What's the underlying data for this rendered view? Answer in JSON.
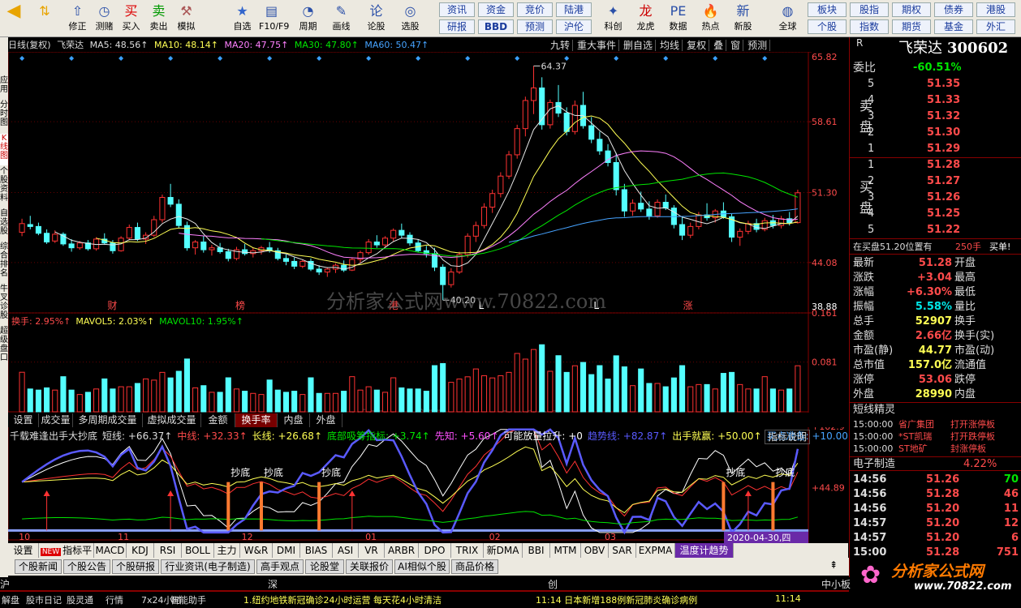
{
  "toolbar": {
    "buttons": [
      {
        "label": "修正",
        "icon": "arrow-up-icon"
      },
      {
        "label": "测赌",
        "icon": "clock-icon"
      },
      {
        "label": "买入",
        "icon": "buy-icon"
      },
      {
        "label": "卖出",
        "icon": "sell-icon"
      },
      {
        "label": "模拟",
        "icon": "hammer-icon"
      },
      {
        "label": "自选",
        "icon": "star-icon"
      },
      {
        "label": "F10/F9",
        "icon": "f10-icon"
      },
      {
        "label": "周期",
        "icon": "period-icon"
      },
      {
        "label": "画线",
        "icon": "pen-icon"
      },
      {
        "label": "论股",
        "icon": "discuss-icon"
      },
      {
        "label": "选股",
        "icon": "select-icon"
      },
      {
        "label": "科创",
        "icon": "science-icon"
      },
      {
        "label": "龙虎",
        "icon": "dragon-icon"
      },
      {
        "label": "数据",
        "icon": "pe-icon"
      },
      {
        "label": "热点",
        "icon": "hot-icon"
      },
      {
        "label": "新股",
        "icon": "newstock-icon"
      },
      {
        "label": "全球",
        "icon": "globe-icon"
      }
    ],
    "small_buttons": [
      "资讯",
      "资金",
      "竞价",
      "陆港",
      "研报",
      "BBD",
      "预测",
      "沪伦"
    ],
    "right_buttons": [
      "板块",
      "股指",
      "期权",
      "债券",
      "港股",
      "个股",
      "指数",
      "期货",
      "基金",
      "外汇"
    ]
  },
  "chart_header": {
    "period": "日线(复权)",
    "name": "飞荣达",
    "ma5": "MA5: 48.56↑",
    "ma10": "MA10: 48.14↑",
    "ma20": "MA20: 47.75↑",
    "ma30": "MA30: 47.80↑",
    "ma60": "MA60: 50.47↑",
    "tools": [
      "九转",
      "重大事件",
      "删自选",
      "均线",
      "复权",
      "叠",
      "窗",
      "预测"
    ]
  },
  "price_axis": [
    "65.82",
    "58.61",
    "51.30",
    "44.08",
    "38.88"
  ],
  "annotations": {
    "high": "64.37",
    "low": "40.20",
    "events": [
      "财",
      "榜",
      "港",
      "L",
      "L",
      "涨"
    ]
  },
  "watermark": "分析家公式网www.70822.com",
  "vol_header": {
    "turnover": "换手: 2.95%↑",
    "mavol5": "MAVOL5: 2.03%↑",
    "mavol10": "MAVOL10: 1.95%↑"
  },
  "vol_axis": [
    "0.161",
    "0.081"
  ],
  "indicator_tabs": [
    "设置",
    "成交量",
    "多周期成交量",
    "虚拟成交量",
    "金额",
    "换手率",
    "内盘",
    "外盘"
  ],
  "indicator_header": {
    "name": "千载难逢出手大抄底",
    "items": [
      "短线: +66.37↑",
      "中线: +32.33↑",
      "长线: +26.68↑",
      "底部吸筹指标: +3.74↑",
      "先知: +5.60↑",
      "可能放量拉升: +0",
      "趋势线: +82.87↑",
      "出手就赢: +50.00↑",
      "买点准备: +10.00"
    ],
    "explain": "指标说明"
  },
  "indicator_axis": [
    "+102.9",
    "+44.89"
  ],
  "chaodi_label": "抄底",
  "date_axis": [
    "10",
    "11",
    "12",
    "01",
    "02",
    "03",
    "04"
  ],
  "date_cursor": "2020-04-30,四",
  "bottom_tabs": [
    "设置",
    "指标平台",
    "MACD",
    "KDJ",
    "RSI",
    "BOLL",
    "主力",
    "W&R",
    "DMI",
    "BIAS",
    "ASI",
    "VR",
    "ARBR",
    "DPO",
    "TRIX",
    "新DMA",
    "BBI",
    "MTM",
    "OBV",
    "SAR",
    "EXPMA",
    "温度计趋势"
  ],
  "new_badge": "NEW",
  "news_tabs": [
    "个股新闻",
    "个股公告",
    "个股研报",
    "行业资讯(电子制造)",
    "高手观点",
    "论股堂",
    "关联报价",
    "AI相似个股",
    "商品价格"
  ],
  "left_tabs": [
    "应用",
    "分时图",
    "K线图",
    "个股资料",
    "自选股",
    "综合排名",
    "牛叉诊股",
    "超级盘口"
  ],
  "quote": {
    "name": "飞荣达",
    "code": "300602",
    "rate_label": "委比",
    "rate": "-60.51%",
    "sell": [
      {
        "n": "5",
        "p": "51.35"
      },
      {
        "n": "4",
        "p": "51.33"
      },
      {
        "n": "3",
        "p": "51.32"
      },
      {
        "n": "2",
        "p": "51.30"
      },
      {
        "n": "1",
        "p": "51.29"
      }
    ],
    "buy": [
      {
        "n": "1",
        "p": "51.28"
      },
      {
        "n": "2",
        "p": "51.27"
      },
      {
        "n": "3",
        "p": "51.26"
      },
      {
        "n": "4",
        "p": "51.25"
      },
      {
        "n": "5",
        "p": "51.22"
      }
    ],
    "sell_label": "卖盘",
    "buy_label": "买盘",
    "order_note": "在买盘51.20位置有",
    "order_qty": "250手",
    "order_action": "买单!",
    "stats": [
      [
        "最新",
        "51.28",
        "开盘",
        ""
      ],
      [
        "涨跌",
        "+3.04",
        "最高",
        ""
      ],
      [
        "涨幅",
        "+6.30%",
        "最低",
        ""
      ],
      [
        "振幅",
        "5.58%",
        "量比",
        ""
      ],
      [
        "总手",
        "52907",
        "换手",
        ""
      ],
      [
        "金额",
        "2.66亿",
        "换手(实)",
        ""
      ],
      [
        "市盈(静)",
        "44.77",
        "市盈(动)",
        ""
      ],
      [
        "总市值",
        "157.0亿",
        "流通值",
        ""
      ],
      [
        "涨停",
        "53.06",
        "跌停",
        ""
      ],
      [
        "外盘",
        "28990",
        "内盘",
        ""
      ]
    ],
    "elves_title": "短线精灵",
    "elves": [
      [
        "15:00:00",
        "省广集团",
        "打开涨停板"
      ],
      [
        "15:00:00",
        "*ST凯瑞",
        "打开跌停板"
      ],
      [
        "15:00:00",
        "ST地矿",
        "封涨停板"
      ]
    ],
    "industry": "电子制造",
    "industry_pct": "4.22%",
    "ticks": [
      [
        "14:56",
        "51.26",
        "70"
      ],
      [
        "14:56",
        "51.28",
        "46"
      ],
      [
        "14:56",
        "51.20",
        "11"
      ],
      [
        "14:57",
        "51.20",
        "12"
      ],
      [
        "14:57",
        "51.20",
        "6"
      ],
      [
        "15:00",
        "51.28",
        "751"
      ]
    ]
  },
  "status": {
    "markets": [
      "沪",
      "深",
      "创",
      "中小板"
    ],
    "items": [
      "解盘",
      "股市日记",
      "股灵通",
      "行情",
      "7x24小时",
      "智能助手"
    ],
    "ticker": "1.纽约地铁新冠确诊24小时运营 每天花4小时清洁",
    "time_news": "11:14 日本新增188例新冠肺炎确诊病例",
    "time2": "11:14"
  },
  "logo": "分析家公式网",
  "logo_url": "www.70822.com",
  "chart_data": {
    "type": "candlestick",
    "price_ylim": [
      38.88,
      65.82
    ],
    "price_ticks": [
      65.82,
      58.61,
      51.3,
      44.08,
      38.88
    ],
    "x_month_labels": [
      "10",
      "11",
      "12",
      "01",
      "02",
      "03",
      "04"
    ],
    "candles": [
      [
        47.2,
        48.6,
        46.8,
        48.1
      ],
      [
        48.0,
        48.9,
        47.5,
        47.8
      ],
      [
        47.8,
        48.2,
        46.9,
        47.1
      ],
      [
        47.1,
        47.5,
        46.0,
        46.2
      ],
      [
        46.3,
        47.4,
        46.1,
        47.0
      ],
      [
        47.0,
        47.2,
        45.8,
        46.0
      ],
      [
        46.0,
        46.5,
        45.2,
        45.6
      ],
      [
        45.6,
        46.3,
        45.4,
        46.1
      ],
      [
        46.1,
        46.4,
        45.3,
        45.5
      ],
      [
        45.5,
        46.7,
        45.3,
        46.5
      ],
      [
        46.5,
        47.1,
        45.9,
        46.1
      ],
      [
        46.1,
        46.4,
        45.0,
        45.3
      ],
      [
        45.3,
        46.8,
        45.2,
        46.6
      ],
      [
        46.6,
        48.0,
        46.4,
        47.7
      ],
      [
        47.7,
        48.2,
        46.3,
        46.5
      ],
      [
        46.5,
        47.2,
        46.0,
        46.9
      ],
      [
        46.9,
        48.9,
        46.7,
        48.5
      ],
      [
        48.5,
        51.1,
        48.2,
        50.8
      ],
      [
        50.8,
        52.2,
        49.8,
        50.1
      ],
      [
        50.1,
        50.6,
        47.6,
        47.9
      ],
      [
        47.9,
        48.3,
        45.3,
        45.6
      ],
      [
        45.6,
        46.4,
        44.9,
        46.2
      ],
      [
        46.2,
        46.8,
        45.1,
        45.4
      ],
      [
        45.4,
        45.9,
        44.8,
        45.6
      ],
      [
        45.6,
        46.1,
        45.0,
        45.2
      ],
      [
        45.2,
        45.5,
        44.2,
        44.5
      ],
      [
        44.5,
        45.7,
        44.3,
        45.4
      ],
      [
        45.4,
        46.0,
        44.8,
        45.0
      ],
      [
        45.0,
        45.6,
        44.6,
        45.3
      ],
      [
        45.3,
        45.8,
        44.9,
        45.6
      ],
      [
        45.6,
        46.2,
        45.1,
        45.3
      ],
      [
        45.3,
        45.6,
        44.3,
        44.5
      ],
      [
        44.5,
        44.9,
        43.8,
        44.2
      ],
      [
        44.2,
        44.6,
        43.4,
        43.7
      ],
      [
        43.7,
        44.4,
        43.5,
        44.2
      ],
      [
        44.2,
        44.5,
        43.2,
        43.4
      ],
      [
        43.4,
        43.8,
        42.8,
        43.1
      ],
      [
        43.1,
        43.6,
        42.6,
        43.4
      ],
      [
        43.4,
        44.0,
        43.0,
        43.8
      ],
      [
        43.8,
        44.3,
        43.1,
        43.3
      ],
      [
        43.3,
        44.6,
        43.2,
        44.4
      ],
      [
        44.4,
        45.3,
        44.0,
        45.1
      ],
      [
        45.1,
        46.5,
        44.9,
        46.2
      ],
      [
        46.2,
        46.9,
        45.6,
        45.9
      ],
      [
        45.9,
        46.8,
        45.7,
        46.6
      ],
      [
        46.6,
        47.6,
        46.3,
        47.4
      ],
      [
        47.4,
        48.1,
        46.6,
        46.9
      ],
      [
        46.9,
        47.2,
        45.8,
        46.1
      ],
      [
        46.1,
        46.5,
        45.1,
        45.3
      ],
      [
        45.3,
        45.8,
        44.6,
        45.0
      ],
      [
        45.0,
        45.6,
        43.2,
        43.6
      ],
      [
        43.6,
        43.9,
        40.2,
        41.8
      ],
      [
        41.8,
        43.5,
        41.5,
        43.1
      ],
      [
        43.1,
        45.2,
        42.9,
        44.9
      ],
      [
        44.9,
        47.1,
        44.6,
        46.8
      ],
      [
        46.8,
        48.3,
        46.2,
        47.9
      ],
      [
        47.9,
        50.2,
        47.6,
        49.8
      ],
      [
        49.8,
        51.6,
        49.2,
        51.2
      ],
      [
        51.2,
        53.4,
        50.8,
        53.0
      ],
      [
        53.0,
        55.6,
        52.7,
        55.2
      ],
      [
        55.2,
        58.3,
        54.8,
        57.9
      ],
      [
        57.9,
        61.2,
        57.1,
        60.8
      ],
      [
        60.8,
        64.37,
        59.4,
        62.1
      ],
      [
        62.1,
        63.2,
        57.8,
        58.3
      ],
      [
        58.3,
        60.9,
        57.9,
        60.6
      ],
      [
        60.6,
        62.4,
        59.1,
        59.5
      ],
      [
        59.5,
        60.1,
        57.2,
        57.6
      ],
      [
        57.6,
        60.8,
        57.3,
        60.3
      ],
      [
        60.3,
        61.7,
        57.9,
        58.2
      ],
      [
        58.2,
        59.1,
        56.4,
        56.8
      ],
      [
        56.8,
        57.6,
        55.2,
        55.6
      ],
      [
        55.6,
        56.3,
        54.0,
        54.4
      ],
      [
        54.4,
        55.4,
        51.0,
        51.6
      ],
      [
        51.6,
        52.2,
        48.8,
        49.4
      ],
      [
        49.4,
        50.6,
        48.9,
        50.2
      ],
      [
        50.2,
        51.4,
        49.3,
        49.6
      ],
      [
        49.6,
        50.4,
        48.5,
        48.9
      ],
      [
        48.9,
        50.6,
        48.7,
        50.3
      ],
      [
        50.3,
        51.1,
        49.5,
        49.7
      ],
      [
        49.7,
        50.0,
        47.6,
        48.0
      ],
      [
        48.0,
        48.8,
        46.4,
        46.9
      ],
      [
        46.9,
        48.2,
        46.6,
        47.8
      ],
      [
        47.8,
        49.3,
        47.5,
        49.0
      ],
      [
        49.0,
        50.2,
        48.4,
        48.7
      ],
      [
        48.7,
        49.6,
        48.2,
        49.4
      ],
      [
        49.4,
        50.3,
        48.6,
        48.8
      ],
      [
        48.8,
        49.1,
        46.2,
        46.7
      ],
      [
        46.7,
        47.6,
        45.8,
        47.3
      ],
      [
        47.3,
        48.4,
        47.0,
        48.1
      ],
      [
        48.1,
        48.6,
        47.2,
        47.5
      ],
      [
        47.5,
        48.7,
        47.3,
        48.4
      ],
      [
        48.4,
        49.0,
        47.6,
        47.9
      ],
      [
        47.9,
        48.9,
        47.6,
        48.6
      ],
      [
        48.6,
        49.3,
        47.9,
        48.2
      ],
      [
        48.2,
        51.6,
        48.1,
        51.28
      ]
    ],
    "volume_ylim": [
      0,
      0.161
    ],
    "volume_ticks": [
      0.161,
      0.081
    ],
    "indicator_ylim": [
      -5,
      102.9
    ],
    "indicator_ticks": [
      102.9,
      44.89
    ]
  }
}
